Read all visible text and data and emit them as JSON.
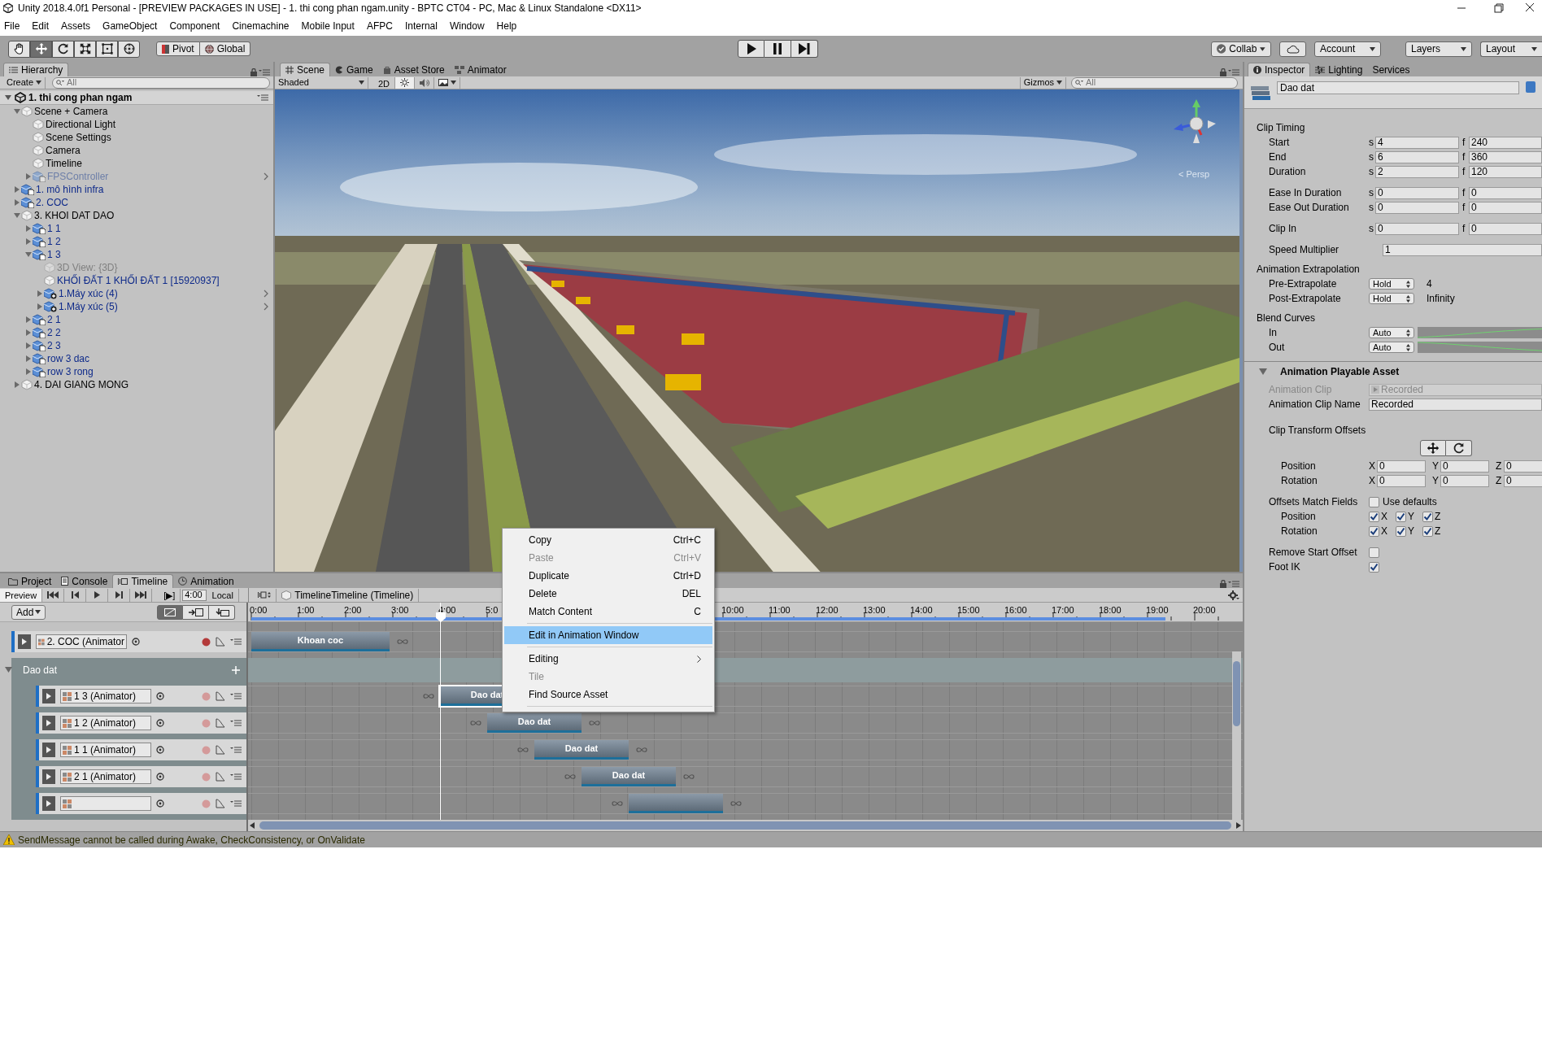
{
  "title_bar": {
    "title": "Unity 2018.4.0f1 Personal - [PREVIEW PACKAGES IN USE] - 1. thi cong phan ngam.unity - BPTC CT04 - PC, Mac & Linux Standalone <DX11>"
  },
  "menu_bar": [
    "File",
    "Edit",
    "Assets",
    "GameObject",
    "Component",
    "Cinemachine",
    "Mobile Input",
    "AFPC",
    "Internal",
    "Window",
    "Help"
  ],
  "toolbar": {
    "tools": [
      {
        "kind": "hand",
        "selected": false
      },
      {
        "kind": "move",
        "selected": true
      },
      {
        "kind": "rotate",
        "selected": false
      },
      {
        "kind": "scale",
        "selected": false
      },
      {
        "kind": "rect",
        "selected": false
      },
      {
        "kind": "transform",
        "selected": false
      }
    ],
    "pivot": "Pivot",
    "global": "Global",
    "playback": [
      {
        "kind": "play"
      },
      {
        "kind": "pause"
      },
      {
        "kind": "step"
      }
    ],
    "collab": "Collab",
    "account": "Account",
    "layers": "Layers",
    "layout": "Layout"
  },
  "hierarchy": {
    "tab": "Hierarchy",
    "create": "Create",
    "search_placeholder": "All",
    "scene": "1. thi cong phan ngam",
    "items": [
      {
        "name": "Scene + Camera",
        "kind": "object",
        "prefab": false,
        "active": true,
        "open_arrow": false,
        "expanded": true,
        "children": [
          {
            "name": "Directional Light",
            "kind": "object",
            "prefab": false,
            "active": true,
            "open_arrow": false
          },
          {
            "name": "Scene Settings",
            "kind": "object",
            "prefab": false,
            "active": true,
            "open_arrow": false
          },
          {
            "name": "Camera",
            "kind": "object",
            "prefab": false,
            "active": true,
            "open_arrow": false
          },
          {
            "name": "Timeline",
            "kind": "object",
            "prefab": false,
            "active": true,
            "open_arrow": false
          },
          {
            "name": "FPSController",
            "kind": "model",
            "prefab": true,
            "active": false,
            "open_arrow": true,
            "expanded": false
          }
        ]
      },
      {
        "name": "1. mô hình infra",
        "kind": "model",
        "prefab": true,
        "active": true,
        "open_arrow": false,
        "expanded": false
      },
      {
        "name": "2. COC",
        "kind": "model",
        "prefab": true,
        "active": true,
        "open_arrow": false,
        "expanded": false
      },
      {
        "name": "3. KHOI DAT DAO",
        "kind": "object",
        "prefab": false,
        "active": true,
        "open_arrow": false,
        "expanded": true,
        "children": [
          {
            "name": "1 1",
            "kind": "model",
            "prefab": true,
            "active": true,
            "open_arrow": false,
            "expanded": false
          },
          {
            "name": "1 2",
            "kind": "model",
            "prefab": true,
            "active": true,
            "open_arrow": false,
            "expanded": false
          },
          {
            "name": "1 3",
            "kind": "model",
            "prefab": true,
            "active": true,
            "open_arrow": false,
            "expanded": true,
            "children": [
              {
                "name": "3D View: {3D}",
                "kind": "object",
                "prefab": false,
                "active": false,
                "open_arrow": false
              },
              {
                "name": "KHỐI ĐẤT 1 KHỐI ĐẤT 1 [15920937]",
                "kind": "object",
                "prefab": true,
                "active": true,
                "open_arrow": false
              },
              {
                "name": "1.Máy xúc (4)",
                "kind": "added",
                "prefab": true,
                "active": true,
                "open_arrow": true,
                "expanded": false
              },
              {
                "name": "1.Máy xúc (5)",
                "kind": "added",
                "prefab": true,
                "active": true,
                "open_arrow": true,
                "expanded": false
              }
            ]
          },
          {
            "name": "2 1",
            "kind": "model",
            "prefab": true,
            "active": true,
            "open_arrow": false,
            "expanded": false
          },
          {
            "name": "2 2",
            "kind": "model",
            "prefab": true,
            "active": true,
            "open_arrow": false,
            "expanded": false
          },
          {
            "name": "2 3",
            "kind": "model",
            "prefab": true,
            "active": true,
            "open_arrow": false,
            "expanded": false
          },
          {
            "name": "row 3 dac",
            "kind": "model",
            "prefab": true,
            "active": true,
            "open_arrow": false,
            "expanded": false
          },
          {
            "name": "row 3 rong",
            "kind": "model",
            "prefab": true,
            "active": true,
            "open_arrow": false,
            "expanded": false
          }
        ]
      },
      {
        "name": "4. DAI GIANG MONG",
        "kind": "object",
        "prefab": false,
        "active": true,
        "open_arrow": false,
        "expanded": false
      }
    ]
  },
  "scene_view": {
    "tabs": [
      {
        "label": "Scene",
        "kind": "scene",
        "selected": true
      },
      {
        "label": "Game",
        "kind": "game",
        "selected": false
      },
      {
        "label": "Asset Store",
        "kind": "store",
        "selected": false
      },
      {
        "label": "Animator",
        "kind": "animator",
        "selected": false
      }
    ],
    "shading": "Shaded",
    "mode_2d": "2D",
    "lighting_on": true,
    "audio_on": false,
    "gizmos": "Gizmos",
    "search_placeholder": "All",
    "projection": "< Persp"
  },
  "inspector": {
    "tabs": [
      {
        "label": "Inspector",
        "kind": "info",
        "selected": true
      },
      {
        "label": "Lighting",
        "kind": "lighting",
        "selected": false
      },
      {
        "label": "Services",
        "kind": "plain",
        "selected": false
      }
    ],
    "name": "Dao dat",
    "sections": [
      {
        "title": "Clip Timing",
        "groups": [
          [
            {
              "kind": "frames",
              "label": "Start",
              "fields": [
                {
                  "unit": "s",
                  "value": "4"
                },
                {
                  "unit": "f",
                  "value": "240"
                }
              ]
            },
            {
              "kind": "frames",
              "label": "End",
              "fields": [
                {
                  "unit": "s",
                  "value": "6"
                },
                {
                  "unit": "f",
                  "value": "360"
                }
              ]
            },
            {
              "kind": "frames",
              "label": "Duration",
              "fields": [
                {
                  "unit": "s",
                  "value": "2"
                },
                {
                  "unit": "f",
                  "value": "120"
                }
              ]
            }
          ],
          [
            {
              "kind": "frames",
              "label": "Ease In Duration",
              "fields": [
                {
                  "unit": "s",
                  "value": "0"
                },
                {
                  "unit": "f",
                  "value": "0"
                }
              ]
            },
            {
              "kind": "frames",
              "label": "Ease Out Duration",
              "fields": [
                {
                  "unit": "s",
                  "value": "0"
                },
                {
                  "unit": "f",
                  "value": "0"
                }
              ]
            }
          ],
          [
            {
              "kind": "frames",
              "label": "Clip In",
              "fields": [
                {
                  "unit": "s",
                  "value": "0"
                },
                {
                  "unit": "f",
                  "value": "0"
                }
              ]
            }
          ],
          [
            {
              "kind": "number",
              "label": "Speed Multiplier",
              "value": "1"
            }
          ]
        ]
      },
      {
        "title": "Animation Extrapolation",
        "groups": [
          [
            {
              "kind": "dropdown",
              "label": "Pre-Extrapolate",
              "value": "Hold",
              "note": "4"
            },
            {
              "kind": "dropdown",
              "label": "Post-Extrapolate",
              "value": "Hold",
              "note": "Infinity"
            }
          ]
        ]
      },
      {
        "title": "Blend Curves",
        "groups": [
          [
            {
              "kind": "curve",
              "label": "In",
              "value": "Auto"
            },
            {
              "kind": "curve",
              "label": "Out",
              "value": "Auto"
            }
          ]
        ]
      }
    ],
    "component": {
      "title": "Animation Playable Asset",
      "expanded": true,
      "groups": [
        [
          {
            "kind": "object",
            "label": "Animation Clip",
            "value": "Recorded",
            "disabled": true
          },
          {
            "kind": "text",
            "label": "Animation Clip Name",
            "value": "Recorded"
          }
        ],
        [
          {
            "kind": "heading",
            "label": "Clip Transform Offsets"
          },
          {
            "kind": "buttons",
            "items": [
              {
                "kind": "move"
              },
              {
                "kind": "rotate"
              }
            ]
          },
          {
            "kind": "vector",
            "label": "Position",
            "axes": [
              {
                "axis": "X",
                "value": "0"
              },
              {
                "axis": "Y",
                "value": "0"
              },
              {
                "axis": "Z",
                "value": "0"
              }
            ]
          },
          {
            "kind": "vector",
            "label": "Rotation",
            "axes": [
              {
                "axis": "X",
                "value": "0"
              },
              {
                "axis": "Y",
                "value": "0"
              },
              {
                "axis": "Z",
                "value": "0"
              }
            ]
          }
        ],
        [
          {
            "kind": "checkbox",
            "label": "Offsets Match Fields",
            "text": "Use defaults",
            "checked": false
          },
          {
            "kind": "checks",
            "label": "Position",
            "axes": [
              {
                "axis": "X",
                "checked": true
              },
              {
                "axis": "Y",
                "checked": true
              },
              {
                "axis": "Z",
                "checked": true
              }
            ]
          },
          {
            "kind": "checks",
            "label": "Rotation",
            "axes": [
              {
                "axis": "X",
                "checked": true
              },
              {
                "axis": "Y",
                "checked": true
              },
              {
                "axis": "Z",
                "checked": true
              }
            ]
          }
        ],
        [
          {
            "kind": "toggle",
            "label": "Remove Start Offset",
            "checked": false
          },
          {
            "kind": "toggle",
            "label": "Foot IK",
            "checked": true
          }
        ]
      ]
    }
  },
  "bottom_tabs": [
    {
      "label": "Project",
      "kind": "project",
      "selected": false
    },
    {
      "label": "Console",
      "kind": "console",
      "selected": false
    },
    {
      "label": "Timeline",
      "kind": "timeline",
      "selected": true
    },
    {
      "label": "Animation",
      "kind": "animation",
      "selected": false
    }
  ],
  "timeline": {
    "preview": {
      "label": "Preview",
      "on": true
    },
    "transport": [
      {
        "kind": "first"
      },
      {
        "kind": "prev"
      },
      {
        "kind": "play"
      },
      {
        "kind": "next"
      },
      {
        "kind": "last"
      }
    ],
    "play_range": "[▶]",
    "time": "4:00",
    "mode": "Local",
    "breadcrumb": "TimelineTimeline (Timeline)",
    "add": "Add",
    "edit_modes": [
      {
        "kind": "mix",
        "selected": true
      },
      {
        "kind": "ripple",
        "selected": false
      },
      {
        "kind": "replace",
        "selected": false
      }
    ],
    "ruler": {
      "left": [
        "0:00",
        "1:00",
        "2:00",
        "3:00",
        "4:00",
        "5:0"
      ],
      "right": [
        "10:00",
        "11:00",
        "12:00",
        "13:00",
        "14:00",
        "15:00",
        "16:00",
        "17:00",
        "18:00",
        "19:00",
        "20:00"
      ]
    },
    "tracks": [
      {
        "kind": "track",
        "name": "2. COC (Animator",
        "record_armed": true,
        "clips": [
          {
            "label": "Khoan coc",
            "selected": false
          }
        ]
      },
      {
        "kind": "group",
        "name": "Dao dat",
        "expanded": true,
        "children": [
          {
            "kind": "track",
            "name": "1 3 (Animator)",
            "record_armed": false,
            "clips": [
              {
                "label": "Dao dat",
                "selected": true
              }
            ]
          },
          {
            "kind": "track",
            "name": "1 2 (Animator)",
            "record_armed": false,
            "clips": [
              {
                "label": "Dao dat",
                "selected": false
              }
            ]
          },
          {
            "kind": "track",
            "name": "1 1 (Animator)",
            "record_armed": false,
            "clips": [
              {
                "label": "Dao dat",
                "selected": false
              }
            ]
          },
          {
            "kind": "track",
            "name": "2 1 (Animator)",
            "record_armed": false,
            "clips": [
              {
                "label": "Dao dat",
                "selected": false
              }
            ]
          },
          {
            "kind": "track",
            "record_armed": false,
            "clips": [
              {
                "selected": false
              }
            ]
          }
        ]
      }
    ]
  },
  "context_menu": [
    {
      "kind": "item",
      "label": "Copy",
      "shortcut": "Ctrl+C",
      "disabled": false,
      "selected": false
    },
    {
      "kind": "item",
      "label": "Paste",
      "shortcut": "Ctrl+V",
      "disabled": true,
      "selected": false
    },
    {
      "kind": "item",
      "label": "Duplicate",
      "shortcut": "Ctrl+D",
      "disabled": false,
      "selected": false
    },
    {
      "kind": "item",
      "label": "Delete",
      "shortcut": "DEL",
      "disabled": false,
      "selected": false
    },
    {
      "kind": "item",
      "label": "Match Content",
      "shortcut": "C",
      "disabled": false,
      "selected": false
    },
    {
      "kind": "separator"
    },
    {
      "kind": "item",
      "label": "Edit in Animation Window",
      "disabled": false,
      "selected": true
    },
    {
      "kind": "separator"
    },
    {
      "kind": "submenu",
      "label": "Editing",
      "disabled": false,
      "selected": false
    },
    {
      "kind": "item",
      "label": "Tile",
      "disabled": true,
      "selected": false
    },
    {
      "kind": "item",
      "label": "Find Source Asset",
      "disabled": false,
      "selected": false
    },
    {
      "kind": "separator"
    }
  ],
  "status_bar": {
    "kind": "warning",
    "message": "SendMessage cannot be called during Awake, CheckConsistency, or OnValidate"
  }
}
